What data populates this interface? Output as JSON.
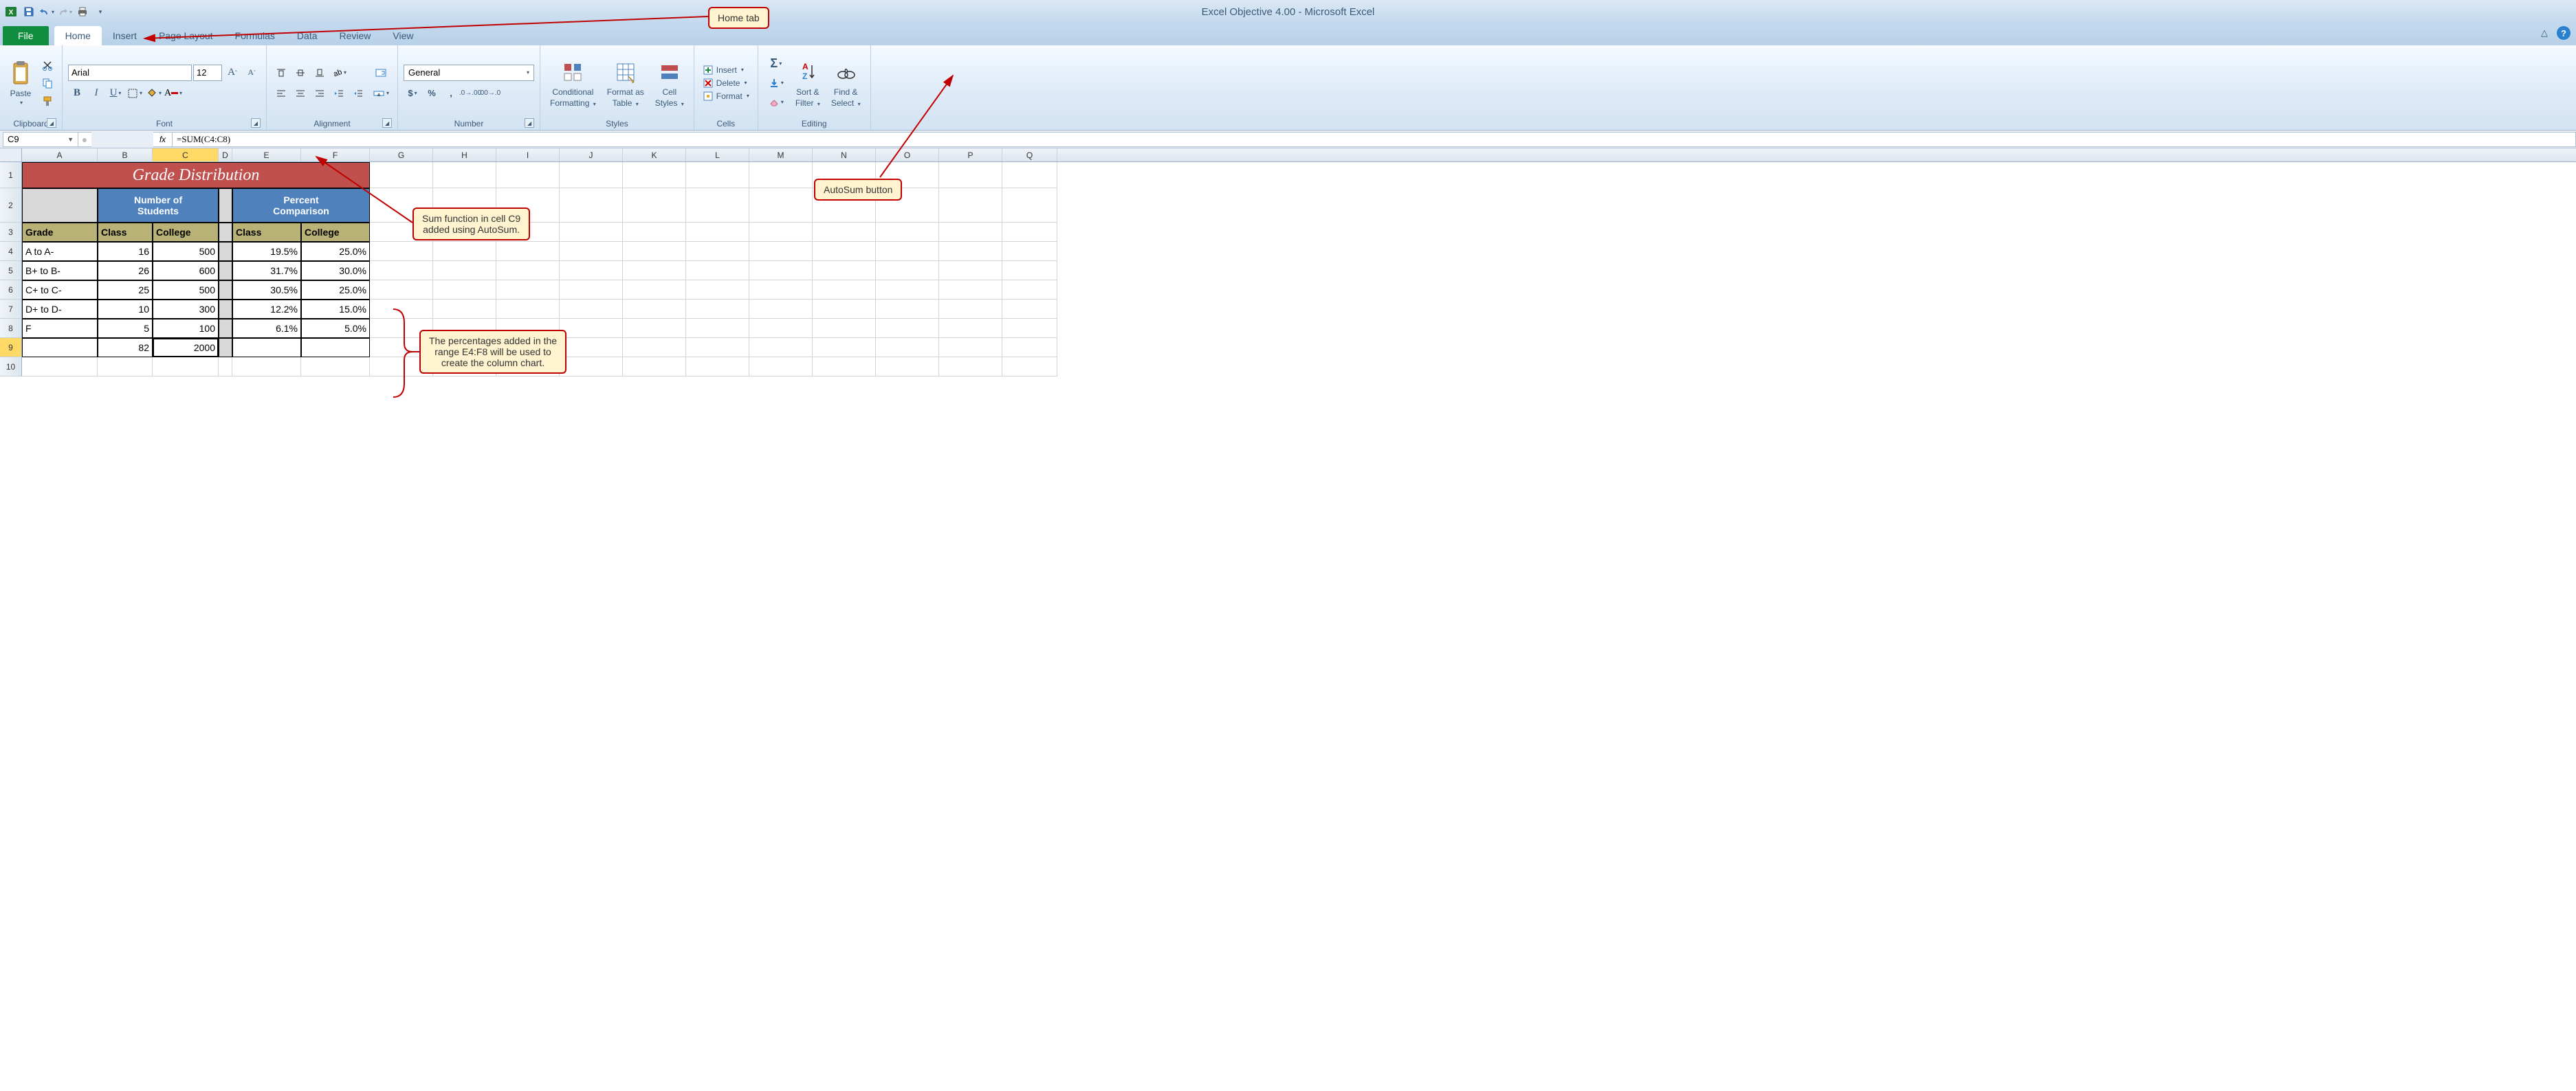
{
  "app": {
    "title": "Excel Objective 4.00 - Microsoft Excel"
  },
  "tabs": {
    "file": "File",
    "home": "Home",
    "insert": "Insert",
    "page_layout": "Page Layout",
    "formulas": "Formulas",
    "data": "Data",
    "review": "Review",
    "view": "View"
  },
  "groups": {
    "clipboard": "Clipboard",
    "font": "Font",
    "alignment": "Alignment",
    "number": "Number",
    "styles": "Styles",
    "cells": "Cells",
    "editing": "Editing"
  },
  "ribbon": {
    "paste": "Paste",
    "font_name": "Arial",
    "font_size": "12",
    "number_format": "General",
    "cond_fmt_1": "Conditional",
    "cond_fmt_2": "Formatting",
    "fmt_table_1": "Format as",
    "fmt_table_2": "Table",
    "cell_styles_1": "Cell",
    "cell_styles_2": "Styles",
    "insert": "Insert",
    "delete": "Delete",
    "format": "Format",
    "sort_1": "Sort &",
    "sort_2": "Filter",
    "find_1": "Find &",
    "find_2": "Select"
  },
  "formula_bar": {
    "name_box": "C9",
    "fx": "fx",
    "formula": "=SUM(C4:C8)"
  },
  "columns": [
    "A",
    "B",
    "C",
    "D",
    "E",
    "F",
    "G",
    "H",
    "I",
    "J",
    "K",
    "L",
    "M",
    "N",
    "O",
    "P",
    "Q"
  ],
  "sheet": {
    "title": "Grade Distribution",
    "h2a": "Number of",
    "h2b": "Students",
    "h2c": "Percent",
    "h2d": "Comparison",
    "h3": {
      "grade": "Grade",
      "class": "Class",
      "college": "College",
      "class2": "Class",
      "college2": "College"
    },
    "rows": [
      {
        "grade": "A to A-",
        "class": "16",
        "college": "500",
        "pclass": "19.5%",
        "pcollege": "25.0%"
      },
      {
        "grade": "B+ to B-",
        "class": "26",
        "college": "600",
        "pclass": "31.7%",
        "pcollege": "30.0%"
      },
      {
        "grade": "C+ to C-",
        "class": "25",
        "college": "500",
        "pclass": "30.5%",
        "pcollege": "25.0%"
      },
      {
        "grade": "D+ to D-",
        "class": "10",
        "college": "300",
        "pclass": "12.2%",
        "pcollege": "15.0%"
      },
      {
        "grade": "F",
        "class": "5",
        "college": "100",
        "pclass": "6.1%",
        "pcollege": "5.0%"
      }
    ],
    "totals": {
      "class": "82",
      "college": "2000"
    }
  },
  "callouts": {
    "home_tab": "Home tab",
    "autosum": "AutoSum button",
    "sum_fn_1": "Sum function in cell C9",
    "sum_fn_2": "added using AutoSum.",
    "pct_1": "The percentages added in the",
    "pct_2": "range E4:F8 will be used to",
    "pct_3": "create the column chart."
  },
  "chart_data": {
    "type": "table",
    "title": "Grade Distribution",
    "columns": [
      "Grade",
      "Class (Number of Students)",
      "College (Number of Students)",
      "Class (Percent Comparison)",
      "College (Percent Comparison)"
    ],
    "rows": [
      [
        "A to A-",
        16,
        500,
        19.5,
        25.0
      ],
      [
        "B+ to B-",
        26,
        600,
        31.7,
        30.0
      ],
      [
        "C+ to C-",
        25,
        500,
        30.5,
        25.0
      ],
      [
        "D+ to D-",
        10,
        300,
        12.2,
        15.0
      ],
      [
        "F",
        5,
        100,
        6.1,
        5.0
      ]
    ],
    "totals": {
      "class": 82,
      "college": 2000
    }
  }
}
